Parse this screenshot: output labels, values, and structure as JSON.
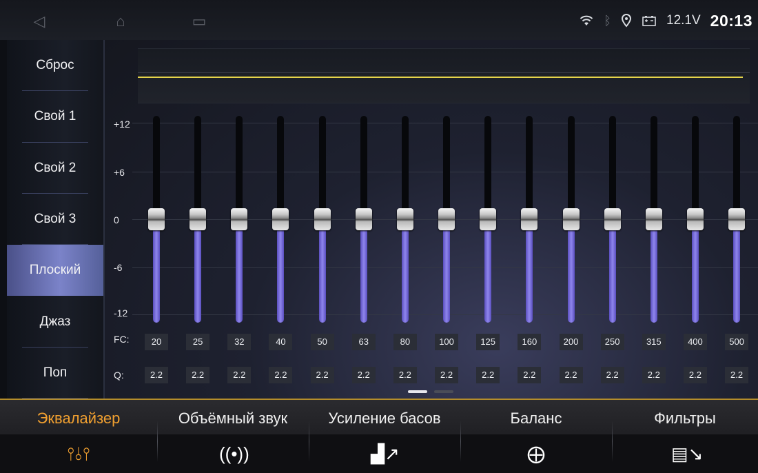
{
  "status": {
    "nav_back": "◁",
    "nav_home": "⌂",
    "nav_recent": "▭",
    "wifi_icon": "wifi-icon",
    "bluetooth_icon": "bluetooth-icon",
    "location_icon": "location-pin-icon",
    "battery_icon": "car-battery-icon",
    "voltage": "12.1V",
    "time": "20:13"
  },
  "presets": [
    {
      "label": "Сброс",
      "active": false
    },
    {
      "label": "Свой 1",
      "active": false
    },
    {
      "label": "Свой 2",
      "active": false
    },
    {
      "label": "Свой 3",
      "active": false
    },
    {
      "label": "Плоский",
      "active": true
    },
    {
      "label": "Джаз",
      "active": false
    },
    {
      "label": "Поп",
      "active": false
    }
  ],
  "eq": {
    "y_labels": [
      "+12",
      "+6",
      "0",
      "-6",
      "-12"
    ],
    "gain_range": [
      -12,
      12
    ],
    "fc_label": "FC:",
    "q_label": "Q:",
    "bands": [
      {
        "fc": "20",
        "q": "2.2",
        "gain": 0
      },
      {
        "fc": "25",
        "q": "2.2",
        "gain": 0
      },
      {
        "fc": "32",
        "q": "2.2",
        "gain": 0
      },
      {
        "fc": "40",
        "q": "2.2",
        "gain": 0
      },
      {
        "fc": "50",
        "q": "2.2",
        "gain": 0
      },
      {
        "fc": "63",
        "q": "2.2",
        "gain": 0
      },
      {
        "fc": "80",
        "q": "2.2",
        "gain": 0
      },
      {
        "fc": "100",
        "q": "2.2",
        "gain": 0
      },
      {
        "fc": "125",
        "q": "2.2",
        "gain": 0
      },
      {
        "fc": "160",
        "q": "2.2",
        "gain": 0
      },
      {
        "fc": "200",
        "q": "2.2",
        "gain": 0
      },
      {
        "fc": "250",
        "q": "2.2",
        "gain": 0
      },
      {
        "fc": "315",
        "q": "2.2",
        "gain": 0
      },
      {
        "fc": "400",
        "q": "2.2",
        "gain": 0
      },
      {
        "fc": "500",
        "q": "2.2",
        "gain": 0
      }
    ],
    "page_index": 0,
    "page_count": 2
  },
  "tabs": [
    {
      "label": "Эквалайзер",
      "icon": "equalizer-sliders-icon",
      "glyph": "⫯⫰⫯",
      "active": true
    },
    {
      "label": "Объёмный звук",
      "icon": "surround-sound-icon",
      "glyph": "((•))",
      "active": false
    },
    {
      "label": "Усиление басов",
      "icon": "bass-boost-icon",
      "glyph": "▟↗",
      "active": false
    },
    {
      "label": "Баланс",
      "icon": "balance-target-icon",
      "glyph": "⨁",
      "active": false
    },
    {
      "label": "Фильтры",
      "icon": "filter-chart-icon",
      "glyph": "▤↘",
      "active": false
    }
  ],
  "colors": {
    "accent": "#f1a030",
    "slider_fill": "#7a70e0",
    "curve": "#e5d34a",
    "preset_active": "#7b83c9"
  }
}
